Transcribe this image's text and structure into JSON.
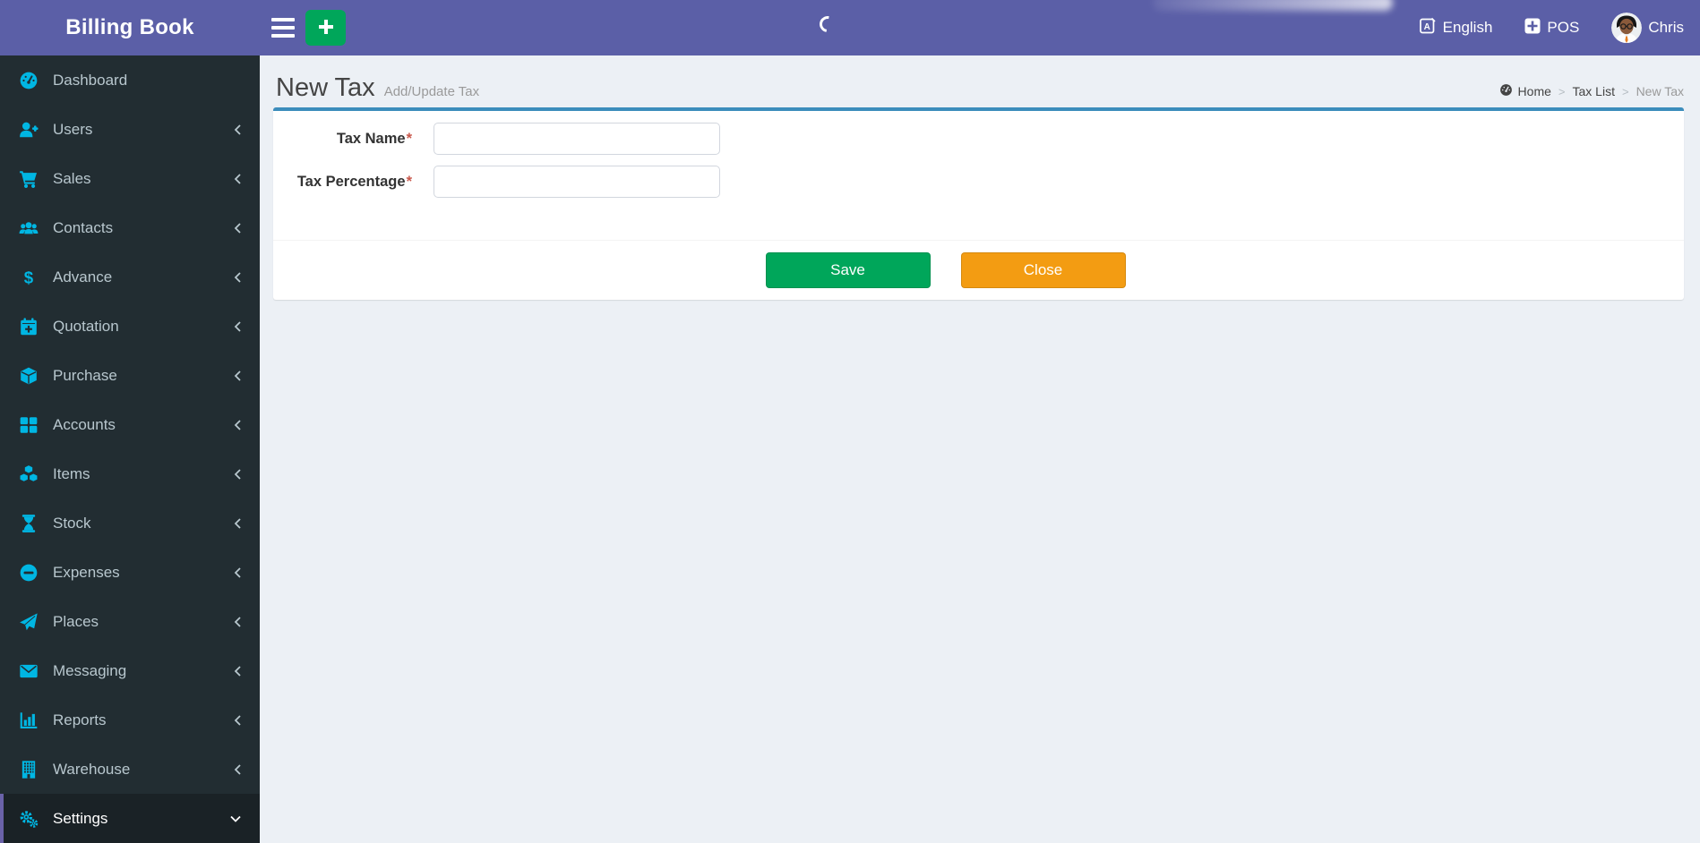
{
  "app": {
    "title": "Billing Book"
  },
  "topbar": {
    "language_label": "English",
    "pos_label": "POS",
    "user_name": "Chris"
  },
  "sidebar": {
    "items": [
      {
        "label": "Dashboard",
        "icon": "dashboard-icon",
        "expandable": false,
        "active": false
      },
      {
        "label": "Users",
        "icon": "user-plus-icon",
        "expandable": true,
        "active": false
      },
      {
        "label": "Sales",
        "icon": "cart-icon",
        "expandable": true,
        "active": false
      },
      {
        "label": "Contacts",
        "icon": "users-icon",
        "expandable": true,
        "active": false
      },
      {
        "label": "Advance",
        "icon": "dollar-icon",
        "expandable": true,
        "active": false
      },
      {
        "label": "Quotation",
        "icon": "calendar-plus-icon",
        "expandable": true,
        "active": false
      },
      {
        "label": "Purchase",
        "icon": "cube-icon",
        "expandable": true,
        "active": false
      },
      {
        "label": "Accounts",
        "icon": "grid-icon",
        "expandable": true,
        "active": false
      },
      {
        "label": "Items",
        "icon": "cubes-icon",
        "expandable": true,
        "active": false
      },
      {
        "label": "Stock",
        "icon": "hourglass-icon",
        "expandable": true,
        "active": false
      },
      {
        "label": "Expenses",
        "icon": "minus-circle-icon",
        "expandable": true,
        "active": false
      },
      {
        "label": "Places",
        "icon": "paper-plane-icon",
        "expandable": true,
        "active": false
      },
      {
        "label": "Messaging",
        "icon": "envelope-icon",
        "expandable": true,
        "active": false
      },
      {
        "label": "Reports",
        "icon": "bar-chart-icon",
        "expandable": true,
        "active": false
      },
      {
        "label": "Warehouse",
        "icon": "building-icon",
        "expandable": true,
        "active": false
      },
      {
        "label": "Settings",
        "icon": "gears-icon",
        "expandable": true,
        "active": true,
        "expanded": true
      }
    ]
  },
  "page": {
    "title": "New Tax",
    "subtitle": "Add/Update Tax"
  },
  "breadcrumb": {
    "separator": ">",
    "items": [
      "Home",
      "Tax List",
      "New Tax"
    ]
  },
  "form": {
    "required_mark": "*",
    "fields": [
      {
        "label": "Tax Name",
        "required": true,
        "value": ""
      },
      {
        "label": "Tax Percentage",
        "required": true,
        "value": ""
      }
    ],
    "save_label": "Save",
    "close_label": "Close"
  },
  "colors": {
    "topbar_purple": "#5b5fa7",
    "sidebar_bg": "#222d32",
    "sidebar_active_bg": "#1a2226",
    "sidebar_icon_cyan": "#00b6e3",
    "panel_accent_blue": "#3c8dbc",
    "save_green": "#00a65a",
    "close_orange": "#f39c12",
    "content_bg": "#ecf0f5",
    "required_red": "#c9584c"
  }
}
